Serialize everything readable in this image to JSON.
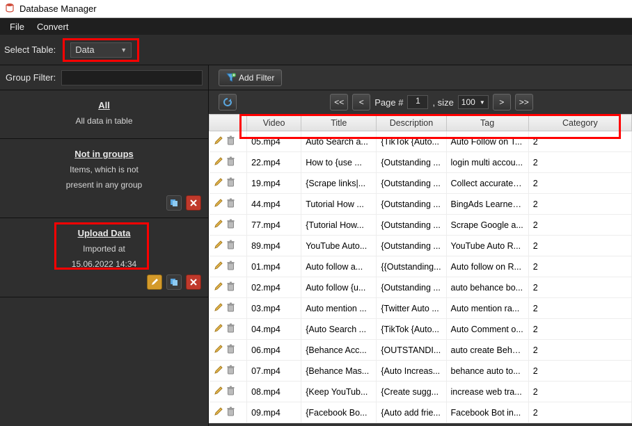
{
  "window": {
    "title": "Database Manager"
  },
  "menu": {
    "file": "File",
    "convert": "Convert"
  },
  "selectrow": {
    "label": "Select Table:",
    "combo_value": "Data"
  },
  "sidebar": {
    "filter_label": "Group Filter:",
    "groups": [
      {
        "title": "All",
        "desc": "All data in table"
      },
      {
        "title": "Not in groups",
        "desc1": "Items, which is not",
        "desc2": "present in any group"
      },
      {
        "title": "Upload Data",
        "desc1": "Imported at",
        "desc2": "15.06.2022 14:34"
      }
    ]
  },
  "toolbar": {
    "add_filter": "Add Filter"
  },
  "paginator": {
    "first": "<<",
    "prev": "<",
    "page_label": "Page #",
    "page": "1",
    "size_label": ", size",
    "size": "100",
    "next": ">",
    "last": ">>"
  },
  "columns": {
    "video": "Video",
    "title": "Title",
    "description": "Description",
    "tag": "Tag",
    "category": "Category"
  },
  "rows": [
    {
      "video": "05.mp4",
      "title": "Auto Search a...",
      "desc": "{TikTok {Auto...",
      "tag": "Auto Follow on T...",
      "cat": "2"
    },
    {
      "video": "22.mp4",
      "title": "How to {use ...",
      "desc": "{Outstanding ...",
      "tag": "login multi accou...",
      "cat": "2"
    },
    {
      "video": "19.mp4",
      "title": "{Scrape links|...",
      "desc": "{Outstanding ...",
      "tag": "Collect accurate i...",
      "cat": "2"
    },
    {
      "video": "44.mp4",
      "title": "Tutorial How ...",
      "desc": "{Outstanding ...",
      "tag": "BingAds Learner ...",
      "cat": "2"
    },
    {
      "video": "77.mp4",
      "title": "{Tutorial How...",
      "desc": "{Outstanding ...",
      "tag": "Scrape Google a...",
      "cat": "2"
    },
    {
      "video": "89.mp4",
      "title": "YouTube Auto...",
      "desc": "{Outstanding ...",
      "tag": "YouTube Auto R...",
      "cat": "2"
    },
    {
      "video": "01.mp4",
      "title": "Auto follow a...",
      "desc": "{{Outstanding...",
      "tag": "Auto follow on R...",
      "cat": "2"
    },
    {
      "video": "02.mp4",
      "title": "Auto follow {u...",
      "desc": "{Outstanding ...",
      "tag": "auto behance bo...",
      "cat": "2"
    },
    {
      "video": "03.mp4",
      "title": "Auto mention ...",
      "desc": "{Twitter Auto ...",
      "tag": "Auto mention ra...",
      "cat": "2"
    },
    {
      "video": "04.mp4",
      "title": "{Auto Search ...",
      "desc": "{TikTok {Auto...",
      "tag": "Auto Comment o...",
      "cat": "2"
    },
    {
      "video": "06.mp4",
      "title": "{Behance Acc...",
      "desc": "{OUTSTANDI...",
      "tag": "auto create Beha...",
      "cat": "2"
    },
    {
      "video": "07.mp4",
      "title": "{Behance Mas...",
      "desc": "{Auto Increas...",
      "tag": "behance auto to...",
      "cat": "2"
    },
    {
      "video": "08.mp4",
      "title": "{Keep YouTub...",
      "desc": "{Create sugg...",
      "tag": "increase web tra...",
      "cat": "2"
    },
    {
      "video": "09.mp4",
      "title": "{Facebook Bo...",
      "desc": "{Auto add frie...",
      "tag": "Facebook Bot in...",
      "cat": "2"
    }
  ]
}
